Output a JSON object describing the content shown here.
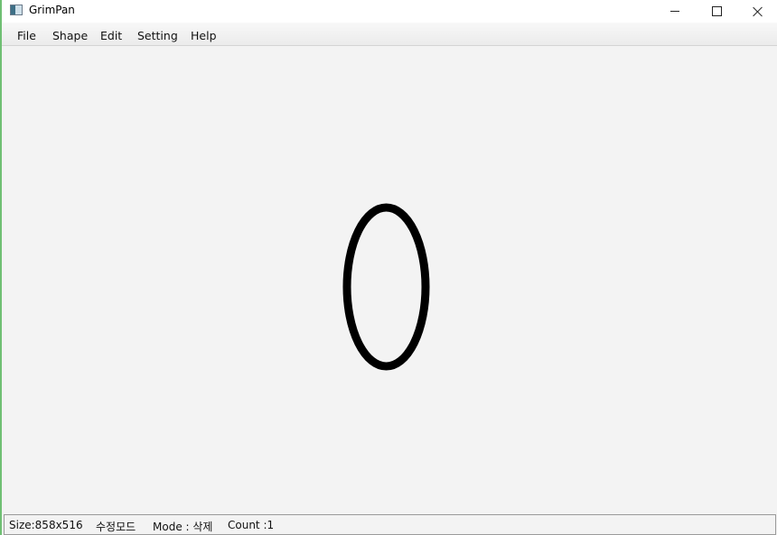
{
  "window": {
    "title": "GrimPan",
    "controls": {
      "minimize": "minimize-icon",
      "maximize": "maximize-icon",
      "close": "close-icon"
    }
  },
  "menu": {
    "file": "File",
    "shape": "Shape",
    "edit": "Edit",
    "setting": "Setting",
    "help": "Help"
  },
  "canvas": {
    "background": "#f3f3f3",
    "shape_color": "#000000",
    "shapes": [
      "ellipse"
    ]
  },
  "status": {
    "size": "Size:858x516",
    "edit_mode": "수정모드",
    "mode": "Mode : 삭제",
    "count": "Count :1"
  }
}
